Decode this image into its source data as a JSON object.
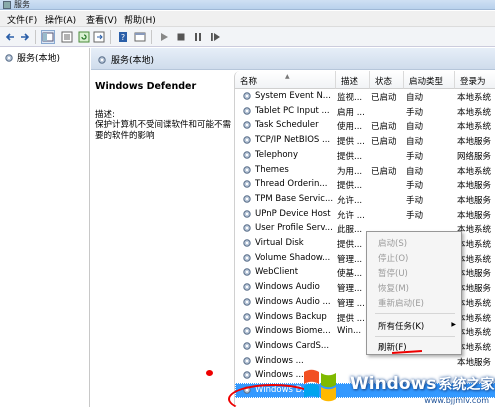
{
  "window": {
    "title": "服务"
  },
  "menu": {
    "file": "文件(F)",
    "action": "操作(A)",
    "view": "查看(V)",
    "help": "帮助(H)"
  },
  "tree": {
    "root_label": "服务(本地)"
  },
  "header": {
    "label": "服务(本地)"
  },
  "description": {
    "service_name": "Windows Defender",
    "label": "描述:",
    "text": "保护计算机不受间谍软件和可能不需要的软件的影响"
  },
  "columns": {
    "name": "名称",
    "desc": "描述",
    "status": "状态",
    "startup": "启动类型",
    "logon": "登录为"
  },
  "rows": [
    {
      "name": "System Event N...",
      "desc": "监视...",
      "status": "已启动",
      "startup": "自动",
      "logon": "本地系统"
    },
    {
      "name": "Tablet PC Input ...",
      "desc": "启用 ...",
      "status": "",
      "startup": "手动",
      "logon": "本地系统"
    },
    {
      "name": "Task Scheduler",
      "desc": "使用...",
      "status": "已启动",
      "startup": "自动",
      "logon": "本地系统"
    },
    {
      "name": "TCP/IP NetBIOS ...",
      "desc": "提供 ...",
      "status": "已启动",
      "startup": "自动",
      "logon": "本地服务"
    },
    {
      "name": "Telephony",
      "desc": "提供...",
      "status": "",
      "startup": "手动",
      "logon": "网络服务"
    },
    {
      "name": "Themes",
      "desc": "为用...",
      "status": "已启动",
      "startup": "自动",
      "logon": "本地系统"
    },
    {
      "name": "Thread Orderin...",
      "desc": "提供...",
      "status": "",
      "startup": "手动",
      "logon": "本地服务"
    },
    {
      "name": "TPM Base Servic...",
      "desc": "允许...",
      "status": "",
      "startup": "手动",
      "logon": "本地服务"
    },
    {
      "name": "UPnP Device Host",
      "desc": "允许 ...",
      "status": "",
      "startup": "手动",
      "logon": "本地服务"
    },
    {
      "name": "User Profile Serv...",
      "desc": "此服...",
      "status": "",
      "startup": "",
      "logon": "本地系统"
    },
    {
      "name": "Virtual Disk",
      "desc": "提供...",
      "status": "",
      "startup": "",
      "logon": "本地系统"
    },
    {
      "name": "Volume Shadow...",
      "desc": "管理...",
      "status": "",
      "startup": "",
      "logon": "本地系统"
    },
    {
      "name": "WebClient",
      "desc": "使基...",
      "status": "",
      "startup": "",
      "logon": "本地服务"
    },
    {
      "name": "Windows Audio",
      "desc": "管理...",
      "status": "",
      "startup": "",
      "logon": "本地服务"
    },
    {
      "name": "Windows Audio ...",
      "desc": "管理 ...",
      "status": "",
      "startup": "",
      "logon": "本地系统"
    },
    {
      "name": "Windows Backup",
      "desc": "提供 ...",
      "status": "",
      "startup": "",
      "logon": "本地系统"
    },
    {
      "name": "Windows Biome...",
      "desc": "Win...",
      "status": "",
      "startup": "",
      "logon": "本地系统"
    },
    {
      "name": "Windows CardS...",
      "desc": "",
      "status": "",
      "startup": "",
      "logon": "本地系统"
    },
    {
      "name": "Windows ...",
      "desc": "",
      "status": "",
      "startup": "",
      "logon": "本地服务"
    },
    {
      "name": "Windows ...",
      "desc": "",
      "status": "",
      "startup": "",
      "logon": ""
    },
    {
      "name": "Windows D...",
      "desc": "",
      "status": "",
      "startup": "",
      "logon": ""
    }
  ],
  "context_menu": {
    "start": "启动(S)",
    "stop": "停止(O)",
    "pause": "暂停(U)",
    "resume": "恢复(M)",
    "restart": "重新启动(E)",
    "all_tasks": "所有任务(K)",
    "refresh": "刷新(F)"
  },
  "watermark": {
    "brand": "Windows",
    "cn": "系统之家",
    "url": "www.bjjmlv.com"
  },
  "colors": {
    "selection": "#3399ff",
    "annotation": "#e00000"
  }
}
